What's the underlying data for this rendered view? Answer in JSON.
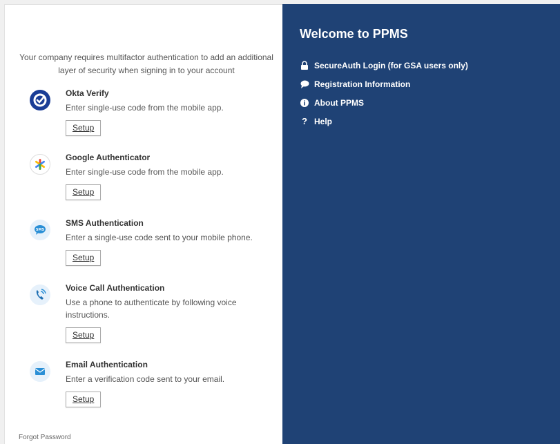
{
  "intro_text": "Your company requires multifactor authentication to add an additional layer of security when signing in to your account",
  "factors": [
    {
      "title": "Okta Verify",
      "description": "Enter single-use code from the mobile app.",
      "button": "Setup"
    },
    {
      "title": "Google Authenticator",
      "description": "Enter single-use code from the mobile app.",
      "button": "Setup"
    },
    {
      "title": "SMS Authentication",
      "description": "Enter a single-use code sent to your mobile phone.",
      "button": "Setup"
    },
    {
      "title": "Voice Call Authentication",
      "description": "Use a phone to authenticate by following voice instructions.",
      "button": "Setup"
    },
    {
      "title": "Email Authentication",
      "description": "Enter a verification code sent to your email.",
      "button": "Setup"
    }
  ],
  "forgot_password": "Forgot Password",
  "sidebar": {
    "title": "Welcome to PPMS",
    "items": [
      {
        "label": "SecureAuth Login (for GSA users only)",
        "icon": "lock-icon"
      },
      {
        "label": "Registration Information",
        "icon": "speech-bubble-icon"
      },
      {
        "label": "About PPMS",
        "icon": "info-icon"
      },
      {
        "label": "Help",
        "icon": "question-icon"
      }
    ]
  },
  "colors": {
    "sidebar_bg": "#1f4275",
    "okta_blue": "#1a3d96",
    "light_icon_bg": "#e6f1fb"
  }
}
